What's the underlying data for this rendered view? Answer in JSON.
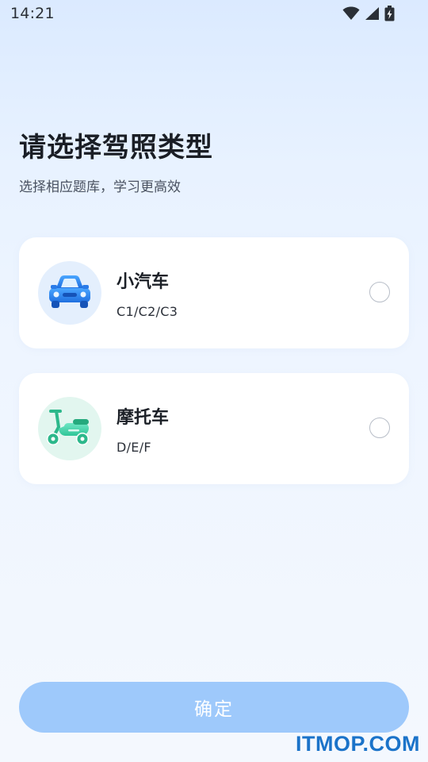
{
  "status_bar": {
    "time": "14:21",
    "icons": [
      "wifi-icon",
      "signal-icon",
      "battery-icon"
    ]
  },
  "header": {
    "title": "请选择驾照类型",
    "subtitle": "选择相应题库，学习更高效"
  },
  "options": [
    {
      "name": "小汽车",
      "codes": "C1/C2/C3",
      "icon": "car-icon",
      "selected": false,
      "icon_color": "#2d8cf0"
    },
    {
      "name": "摩托车",
      "codes": "D/E/F",
      "icon": "scooter-icon",
      "selected": false,
      "icon_color": "#3dd6a8"
    }
  ],
  "confirm": {
    "label": "确定",
    "enabled": false,
    "color": "#9ec9fb"
  },
  "watermark": {
    "text": "ITMOP.COM",
    "color": "#1b73c9"
  }
}
